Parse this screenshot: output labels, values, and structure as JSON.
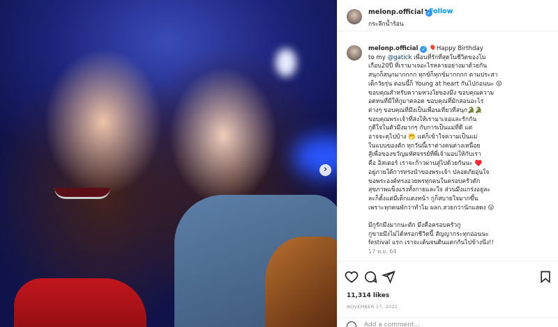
{
  "post": {
    "username": "melonp.official",
    "verified_icon": "verified-badge-icon",
    "dot": "•",
    "follow_label": "Follow",
    "location": "กระลึกน้ำร้อน"
  },
  "caption": {
    "username": "melonp.official",
    "text_part1": " 🎈Happy Birthday\nto my ",
    "mention": "@gatick",
    "text_part2": " เพื่อนที่รักที่สุดในชีวิตของโม\nเกือบ20ปี ที่เรามาเจอะไรหลายอย่างมาด้วยกัน\nสนุกก็สนุกมากกกก ทุกข์ก็ทุกข์มากกกก ตามประสา\nเด็กวัยรุ่น ตอนนี้ก็ Young at heart กันไปก่อนนะ 😛\nขอบคุณสำหรับความหวงใยของมึง ขอบคุณความ\nอดทนที่มีให้กูมาตลอด ขอบคุณที่มักสอนอะไร\nต่างๆ ขอบคุณที่มึงเป็นเพื่อนเที่ยวที่สนุก🐊🐊\nขอบคุณพระเจ้าที่ส่งให้เรามาเจอและรักกัน\nกูดีใจในตัวมึงมากๆ กับการเป็นแม่ที่ดี แต่\nอาจจะดุไปบ้าง 🤭 แต่ก็เข้าใจความเป็นแม่\nในแบบของตัก ทุกวันนี้เราต่างคนต่างเหนื่อย\nสู้เพื่อของขวัญมหัศจรรย์ที่พี่เจ้ามอบให้กับเรา\nคือ อิสเตอร์ เราจะก้าวผ่านสู่ไปด้วยกันนะ ♥️\nอยู่ภายใต้การทรงนำของพระเจ้า ปลอดภัยอุ่นใจ\nขอพระองค์ทรงอวยพรทุกคนในครอบครัวตัก\nสุขภาพแข็งแรงทั้งกายและใจ ส่วนมึงแกร่งอยู่ละ\nละก็ตั้งแต่มีเด็กแดงหน้า กูก็สบายใจมากขึ้น\nเพราะทุกคนพักว่าทำไม ผลก.สวยกว่านักแสดง 😛\n\nมีกูรักมึงมากนะตัก มึงคือครอบครัวกู\nกูขายมึงไม่ได้หรอกชีวิตนี้ สัญญากระทุกอ่อนนะ\nfestival แรก เราจะเต้นจนดินแตกกันไปข้างนึง!!",
    "time": "17 พ.ย. 64"
  },
  "actions": {
    "like_icon": "heart-icon",
    "comment_icon": "comment-icon",
    "share_icon": "share-icon",
    "save_icon": "bookmark-icon",
    "likes": "11,314 likes",
    "date": "NOVEMBER 17, 2021",
    "comment_placeholder": "Add a comment..."
  },
  "carousel": {
    "next_icon": "chevron-right-icon",
    "next_glyph": "›"
  },
  "colors": {
    "accent": "#0095f6",
    "verified": "#3897f0",
    "text": "#262626",
    "muted": "#8e8e8e"
  }
}
